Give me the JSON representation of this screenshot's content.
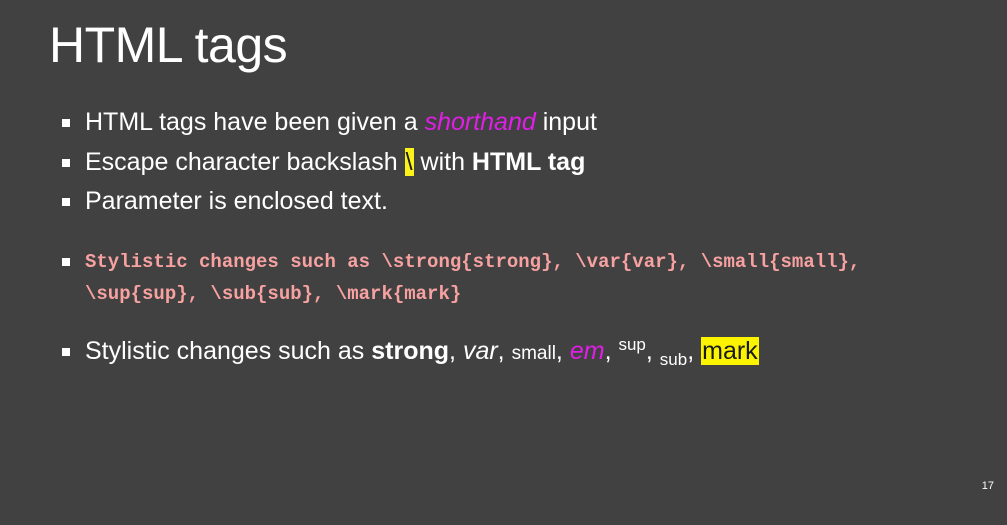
{
  "slide": {
    "title": "HTML tags",
    "page_number": "17"
  },
  "bullets": {
    "b1": {
      "before": "HTML tags have been given a ",
      "emphasis": "shorthand",
      "after": " input"
    },
    "b2": {
      "before": "Escape character backslash ",
      "backslash": "\\",
      "middle": " with ",
      "bold": "HTML tag"
    },
    "b3": {
      "text": "Parameter is enclosed text."
    },
    "b4": {
      "code_text": "Stylistic changes such as \\strong{strong}, \\var{var}, \\small{small}, \\sup{sup}, \\sub{sub}, \\mark{mark}"
    },
    "b5": {
      "intro": "Stylistic changes such as ",
      "strong": "strong",
      "var": "var",
      "small": "small",
      "em": "em",
      "sup": "sup",
      "sub": "sub",
      "mark": "mark",
      "sep": ", "
    }
  },
  "colors": {
    "background": "#414141",
    "text": "#ffffff",
    "emphasis": "#e01ee6",
    "highlight": "#fbf21a",
    "code": "#f7a1a1"
  }
}
